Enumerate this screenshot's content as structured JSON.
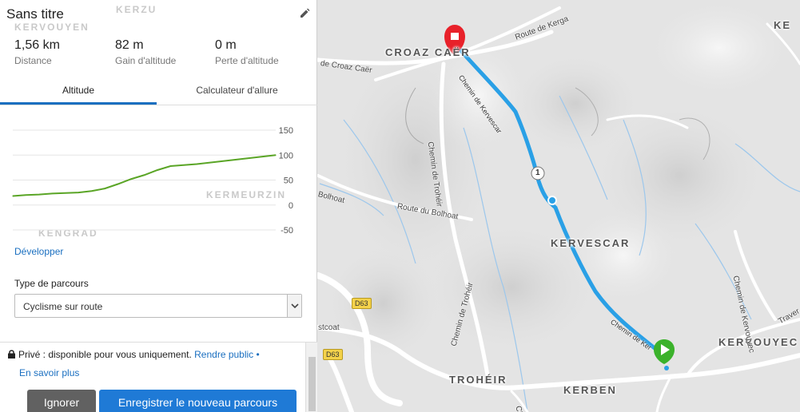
{
  "route": {
    "title": "Sans titre",
    "stats": [
      {
        "value": "1,56 km",
        "label": "Distance"
      },
      {
        "value": "82 m",
        "label": "Gain d'altitude"
      },
      {
        "value": "0 m",
        "label": "Perte d'altitude"
      }
    ]
  },
  "tabs": [
    {
      "label": "Altitude",
      "active": true
    },
    {
      "label": "Calculateur d'allure",
      "active": false
    }
  ],
  "chart_data": {
    "type": "area",
    "title": "",
    "xlabel": "",
    "ylabel": "",
    "ylim": [
      -50,
      150
    ],
    "yticks": [
      150,
      100,
      50,
      0,
      -50
    ],
    "x": [
      0,
      0.05,
      0.1,
      0.15,
      0.2,
      0.25,
      0.3,
      0.35,
      0.4,
      0.45,
      0.5,
      0.55,
      0.6,
      0.65,
      0.7,
      0.75,
      0.8,
      0.85,
      0.9,
      0.95,
      1.0
    ],
    "series": [
      {
        "values": [
          18,
          20,
          21,
          23,
          24,
          25,
          28,
          33,
          42,
          52,
          60,
          70,
          78,
          80,
          82,
          85,
          88,
          91,
          94,
          97,
          100
        ]
      }
    ],
    "line_color": "#5aa526"
  },
  "develop_label": "Développer",
  "route_type": {
    "label": "Type de parcours",
    "selected": "Cyclisme sur route"
  },
  "privacy": {
    "text": "Privé : disponible pour vous uniquement.",
    "make_public": "Rendre public",
    "bullet": "•",
    "learn_more": "En savoir plus"
  },
  "buttons": {
    "ignore": "Ignorer",
    "save": "Enregistrer le nouveau parcours"
  },
  "map": {
    "places": {
      "croaz_caer": "CROAZ CAËR",
      "kervescar": "KERVESCAR",
      "kervouyec": "KERVOUYEC",
      "troheir": "TROHÉIR",
      "kerben": "KERBEN",
      "kerzu": "KERZU",
      "kervouyen": "KERVOUYEN",
      "kermeurzin": "KERMEURZIN",
      "kergrad": "KENGRAD",
      "ke": "KE"
    },
    "roads": {
      "route_kerga": "Route de Kerga",
      "croaz_caer_road": "de Croaz Caër",
      "chemin_troheir": "Chemin de Trohéir",
      "chemin_troheir_2": "Chemin de Trohéir",
      "bolhoat": "Bolhoat",
      "route_bolhoat": "Route du Bolhoat",
      "chemin_kervouyec": "Chemin de Kervouyec",
      "estcoat": "stcoat",
      "traver": "Traver",
      "chemin_kervescar": "Chemin de Kervescar",
      "chemin_ker": "Chemin de Ker",
      "ch": "Ch"
    },
    "shields": [
      "D63",
      "D63"
    ],
    "waypoint": "1",
    "route_color": "#2aa0e6"
  }
}
